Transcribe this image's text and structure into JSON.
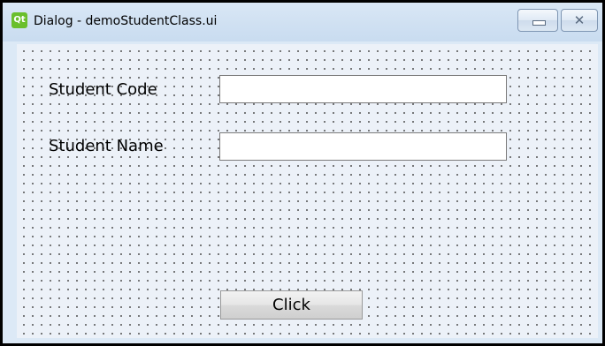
{
  "window": {
    "title": "Dialog - demoStudentClass.ui",
    "app_icon_text": "Qt",
    "app_icon": "qt-icon",
    "minimize_icon": "minimize-icon",
    "close_icon": "close-icon",
    "close_glyph": "✕"
  },
  "form": {
    "student_code_label": "Student Code",
    "student_code_value": "",
    "student_name_label": "Student Name",
    "student_name_value": "",
    "button_label": "Click"
  },
  "colors": {
    "titlebar": "#d9e7f5",
    "client_background": "#ecf1f8",
    "qt_icon": "#6abf2c"
  }
}
